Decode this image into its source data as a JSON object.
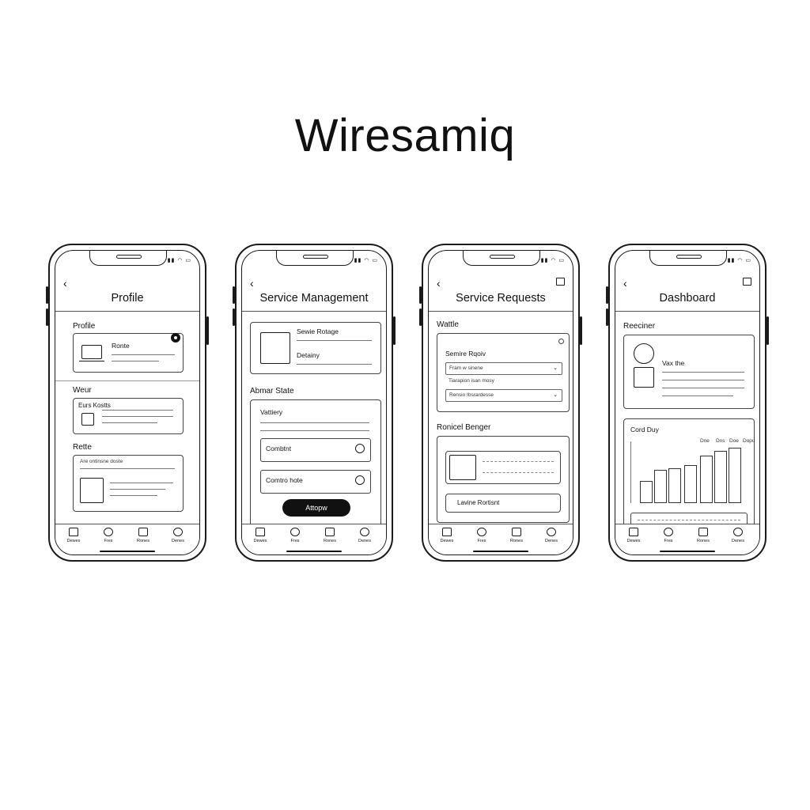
{
  "app_title": "Wiresamiq",
  "tabbar": {
    "labels": [
      "Dewes",
      "Fres",
      "Rones",
      "Denes"
    ]
  },
  "screens": {
    "profile": {
      "title": "Profile",
      "section1": "Profile",
      "card1_label": "Ronte",
      "section2": "Weur",
      "card2_label": "Eurs Kostts",
      "section3": "Rette",
      "card3_label": "Are ontinsne doste"
    },
    "service_management": {
      "title": "Service Management",
      "card1_line1": "Sewie Rotage",
      "card1_line2": "Detainy",
      "section": "Abmar State",
      "form_title": "Vattiery",
      "row1": "Combtnt",
      "row2": "Comtro hote",
      "button": "Attopw"
    },
    "service_requests": {
      "title": "Service Requests",
      "section1": "Wattle",
      "form_title": "Semire Rqoiv",
      "field1": "Fram w sinene",
      "field2_label": "Tiarapion isan mosy",
      "field3": "Rensio Ibsrardesse",
      "section2": "Ronicel Benger",
      "bottom_button": "Lavine Rortisnt"
    },
    "dashboard": {
      "title": "Dashboard",
      "section1": "Reeciner",
      "profile_card_label": "Vax the",
      "chart_title": "Cord Duy",
      "chart_labels": [
        "Dne",
        "Dns",
        "Doe",
        "Dopu"
      ]
    }
  }
}
